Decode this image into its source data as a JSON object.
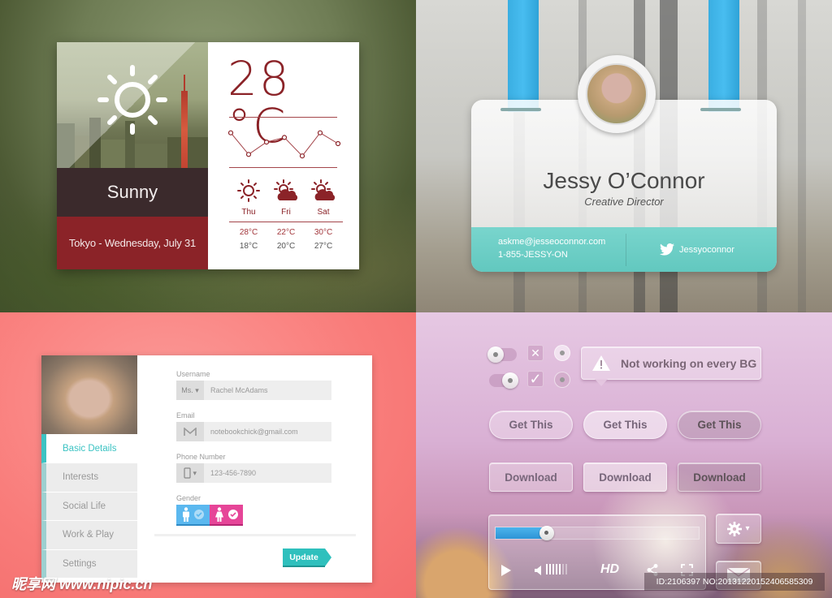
{
  "weather": {
    "condition": "Sunny",
    "location_date": "Tokyo - Wednesday, July 31",
    "current_temp": "28 °C",
    "trend_points": [
      0.15,
      0.85,
      0.45,
      0.3,
      0.9,
      0.15,
      0.5
    ],
    "forecast": [
      {
        "day": "Thu",
        "icon": "sun-icon",
        "high": "28°C",
        "low": "18°C"
      },
      {
        "day": "Fri",
        "icon": "partly-cloudy-icon",
        "high": "22°C",
        "low": "20°C"
      },
      {
        "day": "Sat",
        "icon": "partly-cloudy-icon",
        "high": "30°C",
        "low": "27°C"
      }
    ],
    "accent": "#8b2328"
  },
  "badge": {
    "name": "Jessy O’Connor",
    "title": "Creative Director",
    "email": "askme@jesseoconnor.com",
    "phone": "1-855-JESSY-ON",
    "twitter": "Jessyoconnor",
    "accent": "#62c8bf",
    "strap_color": "#48bdf0"
  },
  "profile": {
    "nav": [
      "Basic Details",
      "Interests",
      "Social Life",
      "Work & Play",
      "Settings"
    ],
    "active_nav": "Basic Details",
    "username_label": "Username",
    "title_select": "Ms.",
    "username_value": "Rachel McAdams",
    "email_label": "Email",
    "email_value": "notebookchick@gmail.com",
    "phone_label": "Phone Number",
    "phone_value": "123-456-7890",
    "gender_label": "Gender",
    "gender_selected": "female",
    "update_label": "Update",
    "accent": "#2fc0bd"
  },
  "controls": {
    "tooltip": "Not working on every BG",
    "get_this": [
      "Get This",
      "Get This",
      "Get This"
    ],
    "download": [
      "Download",
      "Download",
      "Download"
    ],
    "toggle_states": [
      "off",
      "on"
    ],
    "checkbox_states": [
      "x",
      "checked"
    ],
    "radio_states": [
      "unselected",
      "selected"
    ],
    "player": {
      "progress": 0.25,
      "volume_bars_on": 5,
      "volume_bars_total": 7,
      "hd_label": "HD"
    }
  },
  "watermark": {
    "site": "昵享网 www.nipic.cn",
    "id": "ID:2106397 NO:20131220152406585309"
  }
}
